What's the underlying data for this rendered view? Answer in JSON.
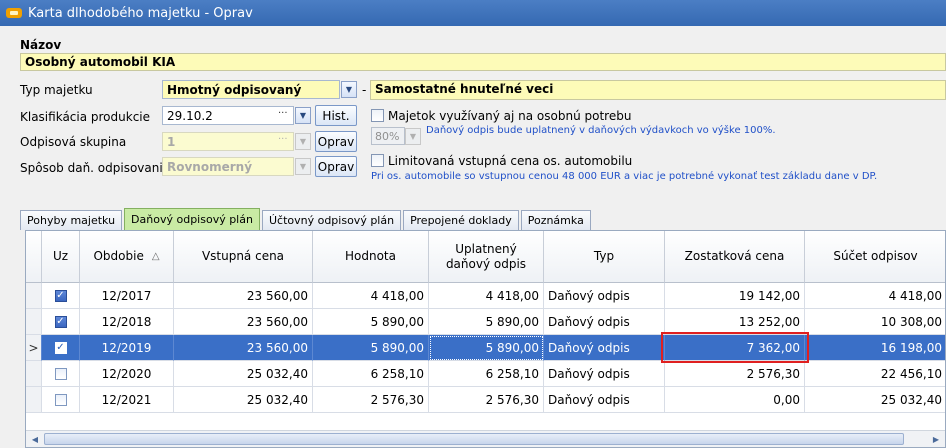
{
  "window": {
    "title": "Karta dlhodobého majetku - Oprav"
  },
  "form": {
    "nazov_label": "Názov",
    "nazov_value": "Osobný automobil KIA",
    "typ_label": "Typ majetku",
    "typ_value": "Hmotný odpisovaný",
    "typ_sep": "-",
    "typ_desc": "Samostatné hnuteľné veci",
    "klasif_label": "Klasifikácia produkcie",
    "klasif_value": "29.10.2",
    "klasif_ellipsis": "···",
    "hist_button": "Hist.",
    "skupina_label": "Odpisová skupina",
    "skupina_value": "1",
    "skupina_ellipsis": "···",
    "oprav_button_1": "Oprav",
    "sposob_label": "Spôsob daň. odpisovania",
    "sposob_value": "Rovnomerný",
    "oprav_button_2": "Oprav",
    "osobna_label": "Majetok využívaný aj na osobnú potrebu",
    "percent_value": "80%",
    "percent_note": "Daňový odpis bude uplatnený v daňových výdavkoch vo výške 100%.",
    "limit_label": "Limitovaná vstupná cena os. automobilu",
    "limit_note": "Pri os. automobile so vstupnou cenou  48 000 EUR a viac je potrebné vykonať test základu dane v DP."
  },
  "tabs": [
    {
      "label": "Pohyby majetku",
      "active": false
    },
    {
      "label": "Daňový odpisový plán",
      "active": true
    },
    {
      "label": "Účtovný odpisový plán",
      "active": false
    },
    {
      "label": "Prepojené doklady",
      "active": false
    },
    {
      "label": "Poznámka",
      "active": false
    }
  ],
  "grid": {
    "columns": [
      "Uz",
      "Obdobie",
      "Vstupná cena",
      "Hodnota",
      "Uplatnený daňový odpis",
      "Typ",
      "Zostatková cena",
      "Súčet odpisov"
    ],
    "sort_indicator": "△",
    "row_indicator": ">",
    "rows": [
      {
        "uz": true,
        "obdobie": "12/2017",
        "vstupna": "23 560,00",
        "hodnota": "4 418,00",
        "uplatneny": "4 418,00",
        "typ": "Daňový odpis",
        "zostatkova": "19 142,00",
        "sucet": "4 418,00",
        "selected": false
      },
      {
        "uz": true,
        "obdobie": "12/2018",
        "vstupna": "23 560,00",
        "hodnota": "5 890,00",
        "uplatneny": "5 890,00",
        "typ": "Daňový odpis",
        "zostatkova": "13 252,00",
        "sucet": "10 308,00",
        "selected": false
      },
      {
        "uz": true,
        "obdobie": "12/2019",
        "vstupna": "23 560,00",
        "hodnota": "5 890,00",
        "uplatneny": "5 890,00",
        "typ": "Daňový odpis",
        "zostatkova": "7 362,00",
        "sucet": "16 198,00",
        "selected": true
      },
      {
        "uz": false,
        "obdobie": "12/2020",
        "vstupna": "25 032,40",
        "hodnota": "6 258,10",
        "uplatneny": "6 258,10",
        "typ": "Daňový odpis",
        "zostatkova": "2 576,30",
        "sucet": "22 456,10",
        "selected": false
      },
      {
        "uz": false,
        "obdobie": "12/2021",
        "vstupna": "25 032,40",
        "hodnota": "2 576,30",
        "uplatneny": "2 576,30",
        "typ": "Daňový odpis",
        "zostatkova": "0,00",
        "sucet": "25 032,40",
        "selected": false
      }
    ]
  },
  "colors": {
    "titlebar": "#3569b2",
    "selected_row": "#3a6fc7",
    "active_tab": "#c9eba4",
    "highlight": "#e02020",
    "input_yellow": "#fdfbb8"
  }
}
